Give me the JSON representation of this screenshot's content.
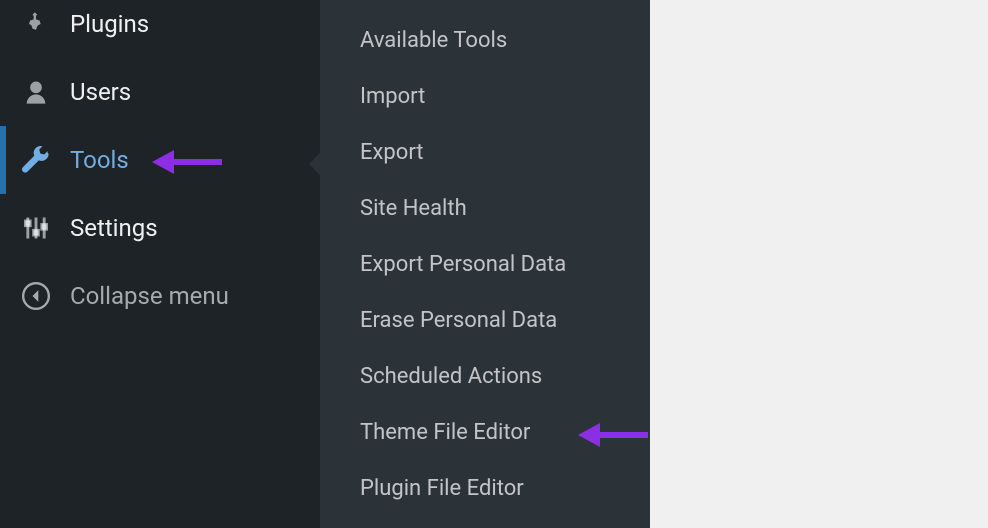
{
  "sidebar": {
    "items": [
      {
        "id": "plugins",
        "label": "Plugins",
        "icon": "plugin-icon"
      },
      {
        "id": "users",
        "label": "Users",
        "icon": "users-icon"
      },
      {
        "id": "tools",
        "label": "Tools",
        "icon": "wrench-icon"
      },
      {
        "id": "settings",
        "label": "Settings",
        "icon": "sliders-icon"
      }
    ],
    "collapse_label": "Collapse menu",
    "active_id": "tools"
  },
  "submenu": {
    "items": [
      "Available Tools",
      "Import",
      "Export",
      "Site Health",
      "Export Personal Data",
      "Erase Personal Data",
      "Scheduled Actions",
      "Theme File Editor",
      "Plugin File Editor"
    ]
  },
  "annotations": {
    "arrow_color": "#8b2ee6"
  }
}
